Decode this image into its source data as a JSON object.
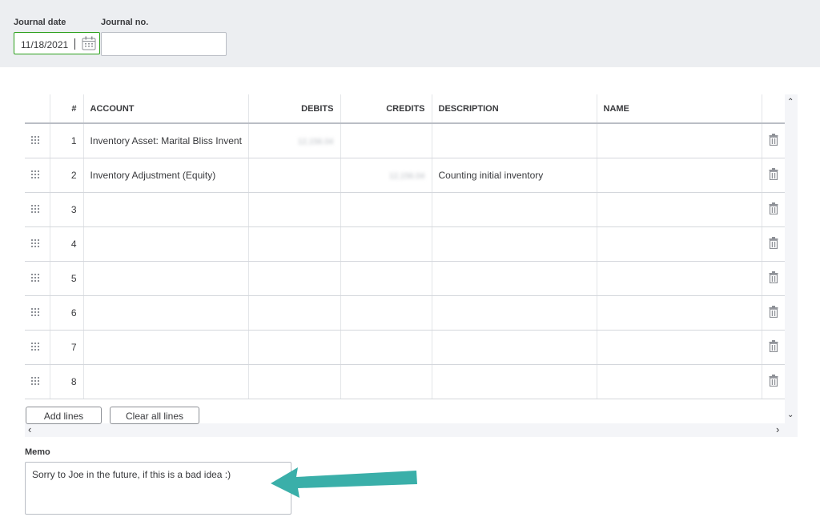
{
  "header": {
    "journal_date_label": "Journal date",
    "journal_no_label": "Journal no.",
    "journal_date_value": "11/18/2021",
    "journal_no_value": ""
  },
  "table": {
    "columns": [
      "#",
      "ACCOUNT",
      "DEBITS",
      "CREDITS",
      "DESCRIPTION",
      "NAME"
    ],
    "rows": [
      {
        "num": "1",
        "account": "Inventory Asset: Marital Bliss Invent",
        "debits": "12,156.04",
        "credits": "",
        "description": "",
        "name": ""
      },
      {
        "num": "2",
        "account": "Inventory Adjustment (Equity)",
        "debits": "",
        "credits": "12,156.04",
        "description": "Counting initial inventory",
        "name": ""
      },
      {
        "num": "3",
        "account": "",
        "debits": "",
        "credits": "",
        "description": "",
        "name": ""
      },
      {
        "num": "4",
        "account": "",
        "debits": "",
        "credits": "",
        "description": "",
        "name": ""
      },
      {
        "num": "5",
        "account": "",
        "debits": "",
        "credits": "",
        "description": "",
        "name": ""
      },
      {
        "num": "6",
        "account": "",
        "debits": "",
        "credits": "",
        "description": "",
        "name": ""
      },
      {
        "num": "7",
        "account": "",
        "debits": "",
        "credits": "",
        "description": "",
        "name": ""
      },
      {
        "num": "8",
        "account": "",
        "debits": "",
        "credits": "",
        "description": "",
        "name": ""
      }
    ]
  },
  "buttons": {
    "add_lines": "Add lines",
    "clear_all_lines": "Clear all lines"
  },
  "memo": {
    "label": "Memo",
    "value": "Sorry to Joe in the future, if this is a bad idea :)"
  },
  "colors": {
    "accent_green": "#2ca01c",
    "annotation_arrow": "#3aafa9",
    "band_bg": "#eceef1"
  },
  "icons": {
    "calendar": "calendar-icon",
    "drag": "drag-handle-icon",
    "delete": "trash-icon",
    "scroll_up": "chevron-up-icon",
    "scroll_down": "chevron-down-icon",
    "scroll_left": "chevron-left-icon",
    "scroll_right": "chevron-right-icon",
    "annotation": "arrow-left-icon"
  }
}
